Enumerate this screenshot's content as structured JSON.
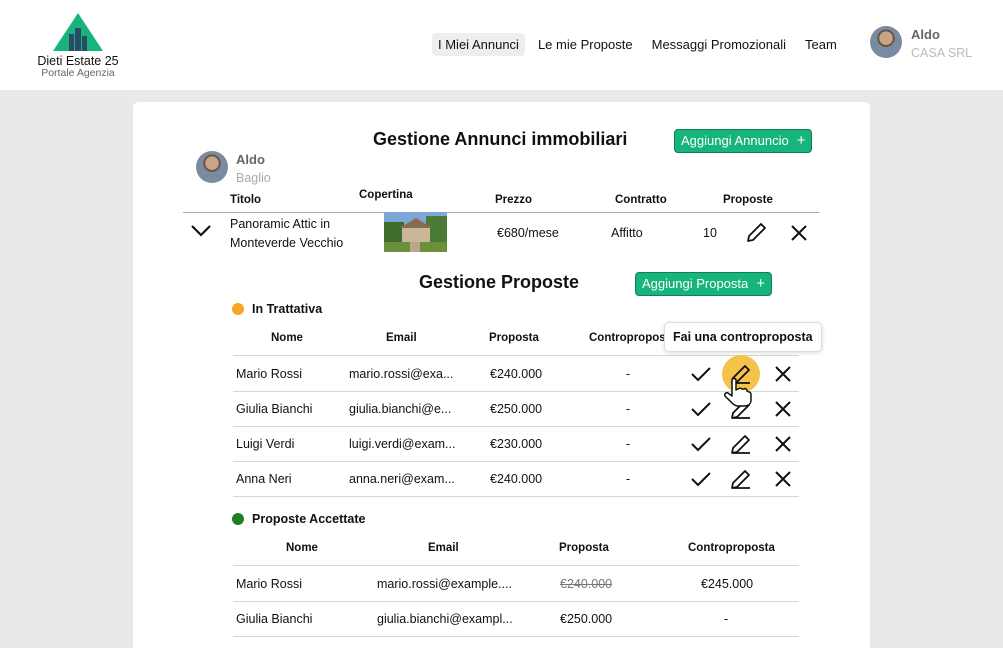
{
  "header": {
    "brand_name": "Dieti Estate 25",
    "brand_sub": "Portale Agenzia",
    "nav": [
      "I Miei Annunci",
      "Le mie Proposte",
      "Messaggi Promozionali",
      "Team"
    ],
    "user_name": "Aldo",
    "user_company": "CASA SRL"
  },
  "listings": {
    "title": "Gestione Annunci immobiliari",
    "add_button": "Aggiungi Annuncio",
    "agent_first": "Aldo",
    "agent_last": "Baglio",
    "columns": [
      "Titolo",
      "Copertina",
      "Prezzo",
      "Contratto",
      "Proposte"
    ],
    "row": {
      "title_line1": "Panoramic Attic in",
      "title_line2": "Monteverde Vecchio",
      "price": "€680/mese",
      "contract": "Affitto",
      "proposals": "10"
    }
  },
  "proposals": {
    "title": "Gestione Proposte",
    "add_button": "Aggiungi Proposta",
    "pending_label": "In Trattativa",
    "columns": [
      "Nome",
      "Email",
      "Proposta",
      "Controproposta"
    ],
    "tooltip": "Fai una controproposta",
    "pending": [
      {
        "name": "Mario Rossi",
        "email": "mario.rossi@exa...",
        "amount": "€240.000",
        "counter": "-"
      },
      {
        "name": "Giulia Bianchi",
        "email": "giulia.bianchi@e...",
        "amount": "€250.000",
        "counter": "-"
      },
      {
        "name": "Luigi Verdi",
        "email": "luigi.verdi@exam...",
        "amount": "€230.000",
        "counter": "-"
      },
      {
        "name": "Anna Neri",
        "email": "anna.neri@exam...",
        "amount": "€240.000",
        "counter": "-"
      }
    ],
    "accepted_label": "Proposte Accettate",
    "accepted": [
      {
        "name": "Mario Rossi",
        "email": "mario.rossi@example....",
        "amount": "€240.000",
        "counter": "€245.000"
      },
      {
        "name": "Giulia Bianchi",
        "email": "giulia.bianchi@exampl...",
        "amount": "€250.000",
        "counter": "-"
      }
    ]
  },
  "colors": {
    "accent": "#17b57c",
    "pending_dot": "#f5a623",
    "accepted_dot": "#1e7f1e",
    "highlight": "#f5c24b"
  }
}
